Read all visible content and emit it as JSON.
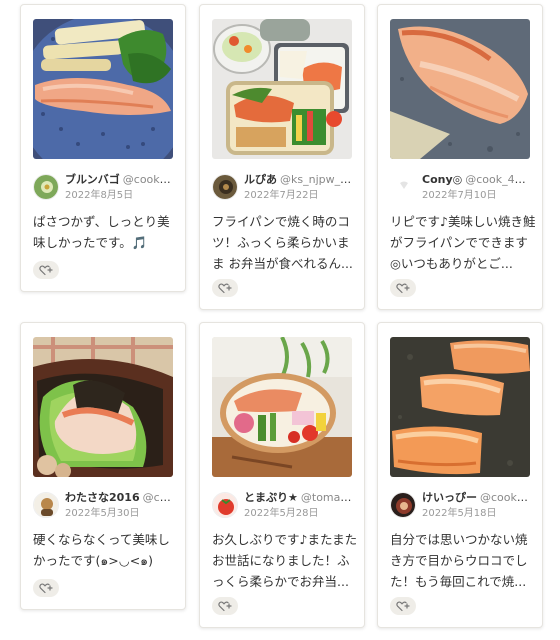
{
  "cards": [
    {
      "nick": "ブルンバゴ",
      "handle": "@cook_4...",
      "date": "2022年8月5日",
      "comment": "ぱさつかず、しっとり美味しかったです。🎵"
    },
    {
      "nick": "ルぴあ",
      "handle": "@ks_njpw_gb",
      "date": "2022年7月22日",
      "comment": "フライパンで焼く時のコツ！ふっくら柔らかいまま お弁当が食べれるん..."
    },
    {
      "nick": "Cony◎",
      "handle": "@cook_401...",
      "date": "2022年7月10日",
      "comment": "リピです♪美味しい焼き鮭がフライパンでできます◎いつもありがとご..."
    },
    {
      "nick": "わたさな2016",
      "handle": "@coo...",
      "date": "2022年5月30日",
      "comment": "硬くならなくって美味しかったです(๑>◡<๑)"
    },
    {
      "nick": "とまぷり★",
      "handle": "@tomap...",
      "date": "2022年5月28日",
      "comment": "お久しぶりです♪またまたお世話になりました！ふっくら柔らかでお弁当..."
    },
    {
      "nick": "けいっぴー",
      "handle": "@cook_4...",
      "date": "2022年5月18日",
      "comment": "自分では思いつかない焼き方で目からウロコでした！もう毎回これで焼..."
    }
  ],
  "icons": {
    "thanks": "heart-plus-icon"
  },
  "colors": {
    "card_border": "#e6e4df",
    "thanks_bg": "#efede8",
    "salmon": "#e8875a"
  }
}
